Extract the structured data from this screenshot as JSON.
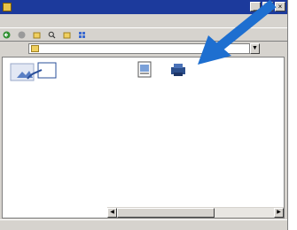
{
  "window": {
    "title": "",
    "controls": [
      "_",
      "□",
      "×"
    ]
  },
  "menu": [
    "",
    "",
    "",
    "",
    "",
    ""
  ],
  "toolbar": [
    "",
    "",
    "",
    "",
    "",
    ""
  ],
  "address": {
    "label": "",
    "value": "",
    "go_label": ""
  },
  "left_pane": {
    "title": "",
    "lines": [
      "",
      "",
      "",
      "",
      ""
    ],
    "link": ""
  },
  "files": [
    {
      "icon": "image-file-icon",
      "caption": "",
      "selected": false
    },
    {
      "icon": "printer-icon",
      "caption": "",
      "selected": true
    }
  ],
  "status": {
    "text": ""
  },
  "colors": {
    "title_bar": "#1c3a9c",
    "selection": "#0a246a",
    "pointer_arrow": "#1e6fd0",
    "link": "#1a3ad0"
  }
}
